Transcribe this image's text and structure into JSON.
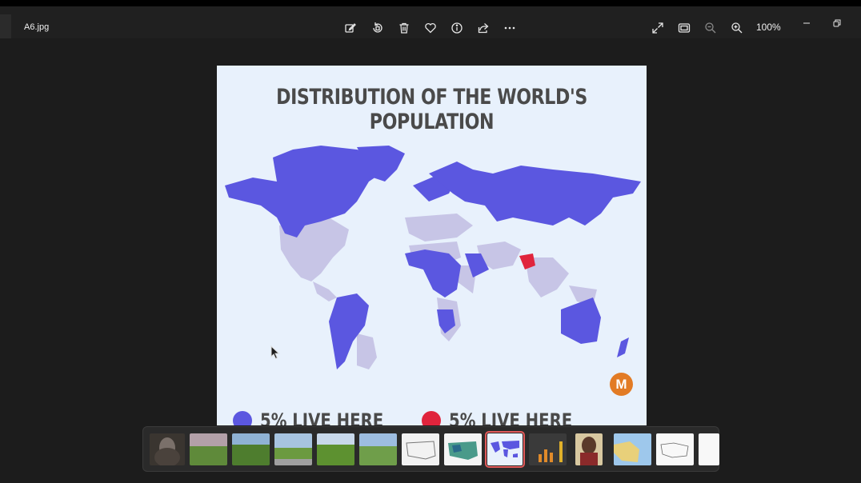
{
  "window": {
    "filename": "A6.jpg",
    "zoom": "100%"
  },
  "toolbar": {
    "icons": [
      "edit-icon",
      "rotate-icon",
      "delete-icon",
      "favorite-icon",
      "info-icon",
      "share-icon",
      "more-icon"
    ],
    "right_icons": [
      "fullscreen-icon",
      "fit-window-icon",
      "zoom-out-icon",
      "zoom-in-icon"
    ]
  },
  "image": {
    "title": "DISTRIBUTION OF THE WORLD'S POPULATION",
    "logo_letter": "M",
    "legend": [
      {
        "label": "5% LIVE HERE",
        "color": "#5b57e0"
      },
      {
        "label": "5% LIVE HERE",
        "color": "#e0243c"
      }
    ],
    "colors": {
      "background": "#e8f1fc",
      "highlight": "#5b57e0",
      "other_land": "#c7c5e6",
      "red_region": "#e0243c"
    }
  },
  "filmstrip": {
    "count": 14,
    "selected_index": 8
  }
}
